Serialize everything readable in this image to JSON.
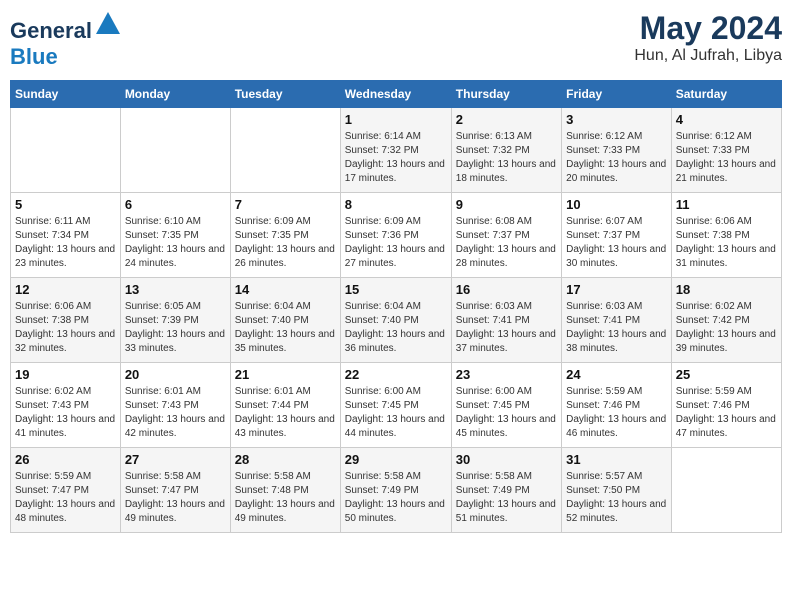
{
  "header": {
    "logo_general": "General",
    "logo_blue": "Blue",
    "month": "May 2024",
    "location": "Hun, Al Jufrah, Libya"
  },
  "days_of_week": [
    "Sunday",
    "Monday",
    "Tuesday",
    "Wednesday",
    "Thursday",
    "Friday",
    "Saturday"
  ],
  "weeks": [
    [
      {
        "day": "",
        "sunrise": "",
        "sunset": "",
        "daylight": ""
      },
      {
        "day": "",
        "sunrise": "",
        "sunset": "",
        "daylight": ""
      },
      {
        "day": "",
        "sunrise": "",
        "sunset": "",
        "daylight": ""
      },
      {
        "day": "1",
        "sunrise": "Sunrise: 6:14 AM",
        "sunset": "Sunset: 7:32 PM",
        "daylight": "Daylight: 13 hours and 17 minutes."
      },
      {
        "day": "2",
        "sunrise": "Sunrise: 6:13 AM",
        "sunset": "Sunset: 7:32 PM",
        "daylight": "Daylight: 13 hours and 18 minutes."
      },
      {
        "day": "3",
        "sunrise": "Sunrise: 6:12 AM",
        "sunset": "Sunset: 7:33 PM",
        "daylight": "Daylight: 13 hours and 20 minutes."
      },
      {
        "day": "4",
        "sunrise": "Sunrise: 6:12 AM",
        "sunset": "Sunset: 7:33 PM",
        "daylight": "Daylight: 13 hours and 21 minutes."
      }
    ],
    [
      {
        "day": "5",
        "sunrise": "Sunrise: 6:11 AM",
        "sunset": "Sunset: 7:34 PM",
        "daylight": "Daylight: 13 hours and 23 minutes."
      },
      {
        "day": "6",
        "sunrise": "Sunrise: 6:10 AM",
        "sunset": "Sunset: 7:35 PM",
        "daylight": "Daylight: 13 hours and 24 minutes."
      },
      {
        "day": "7",
        "sunrise": "Sunrise: 6:09 AM",
        "sunset": "Sunset: 7:35 PM",
        "daylight": "Daylight: 13 hours and 26 minutes."
      },
      {
        "day": "8",
        "sunrise": "Sunrise: 6:09 AM",
        "sunset": "Sunset: 7:36 PM",
        "daylight": "Daylight: 13 hours and 27 minutes."
      },
      {
        "day": "9",
        "sunrise": "Sunrise: 6:08 AM",
        "sunset": "Sunset: 7:37 PM",
        "daylight": "Daylight: 13 hours and 28 minutes."
      },
      {
        "day": "10",
        "sunrise": "Sunrise: 6:07 AM",
        "sunset": "Sunset: 7:37 PM",
        "daylight": "Daylight: 13 hours and 30 minutes."
      },
      {
        "day": "11",
        "sunrise": "Sunrise: 6:06 AM",
        "sunset": "Sunset: 7:38 PM",
        "daylight": "Daylight: 13 hours and 31 minutes."
      }
    ],
    [
      {
        "day": "12",
        "sunrise": "Sunrise: 6:06 AM",
        "sunset": "Sunset: 7:38 PM",
        "daylight": "Daylight: 13 hours and 32 minutes."
      },
      {
        "day": "13",
        "sunrise": "Sunrise: 6:05 AM",
        "sunset": "Sunset: 7:39 PM",
        "daylight": "Daylight: 13 hours and 33 minutes."
      },
      {
        "day": "14",
        "sunrise": "Sunrise: 6:04 AM",
        "sunset": "Sunset: 7:40 PM",
        "daylight": "Daylight: 13 hours and 35 minutes."
      },
      {
        "day": "15",
        "sunrise": "Sunrise: 6:04 AM",
        "sunset": "Sunset: 7:40 PM",
        "daylight": "Daylight: 13 hours and 36 minutes."
      },
      {
        "day": "16",
        "sunrise": "Sunrise: 6:03 AM",
        "sunset": "Sunset: 7:41 PM",
        "daylight": "Daylight: 13 hours and 37 minutes."
      },
      {
        "day": "17",
        "sunrise": "Sunrise: 6:03 AM",
        "sunset": "Sunset: 7:41 PM",
        "daylight": "Daylight: 13 hours and 38 minutes."
      },
      {
        "day": "18",
        "sunrise": "Sunrise: 6:02 AM",
        "sunset": "Sunset: 7:42 PM",
        "daylight": "Daylight: 13 hours and 39 minutes."
      }
    ],
    [
      {
        "day": "19",
        "sunrise": "Sunrise: 6:02 AM",
        "sunset": "Sunset: 7:43 PM",
        "daylight": "Daylight: 13 hours and 41 minutes."
      },
      {
        "day": "20",
        "sunrise": "Sunrise: 6:01 AM",
        "sunset": "Sunset: 7:43 PM",
        "daylight": "Daylight: 13 hours and 42 minutes."
      },
      {
        "day": "21",
        "sunrise": "Sunrise: 6:01 AM",
        "sunset": "Sunset: 7:44 PM",
        "daylight": "Daylight: 13 hours and 43 minutes."
      },
      {
        "day": "22",
        "sunrise": "Sunrise: 6:00 AM",
        "sunset": "Sunset: 7:45 PM",
        "daylight": "Daylight: 13 hours and 44 minutes."
      },
      {
        "day": "23",
        "sunrise": "Sunrise: 6:00 AM",
        "sunset": "Sunset: 7:45 PM",
        "daylight": "Daylight: 13 hours and 45 minutes."
      },
      {
        "day": "24",
        "sunrise": "Sunrise: 5:59 AM",
        "sunset": "Sunset: 7:46 PM",
        "daylight": "Daylight: 13 hours and 46 minutes."
      },
      {
        "day": "25",
        "sunrise": "Sunrise: 5:59 AM",
        "sunset": "Sunset: 7:46 PM",
        "daylight": "Daylight: 13 hours and 47 minutes."
      }
    ],
    [
      {
        "day": "26",
        "sunrise": "Sunrise: 5:59 AM",
        "sunset": "Sunset: 7:47 PM",
        "daylight": "Daylight: 13 hours and 48 minutes."
      },
      {
        "day": "27",
        "sunrise": "Sunrise: 5:58 AM",
        "sunset": "Sunset: 7:47 PM",
        "daylight": "Daylight: 13 hours and 49 minutes."
      },
      {
        "day": "28",
        "sunrise": "Sunrise: 5:58 AM",
        "sunset": "Sunset: 7:48 PM",
        "daylight": "Daylight: 13 hours and 49 minutes."
      },
      {
        "day": "29",
        "sunrise": "Sunrise: 5:58 AM",
        "sunset": "Sunset: 7:49 PM",
        "daylight": "Daylight: 13 hours and 50 minutes."
      },
      {
        "day": "30",
        "sunrise": "Sunrise: 5:58 AM",
        "sunset": "Sunset: 7:49 PM",
        "daylight": "Daylight: 13 hours and 51 minutes."
      },
      {
        "day": "31",
        "sunrise": "Sunrise: 5:57 AM",
        "sunset": "Sunset: 7:50 PM",
        "daylight": "Daylight: 13 hours and 52 minutes."
      },
      {
        "day": "",
        "sunrise": "",
        "sunset": "",
        "daylight": ""
      }
    ]
  ]
}
